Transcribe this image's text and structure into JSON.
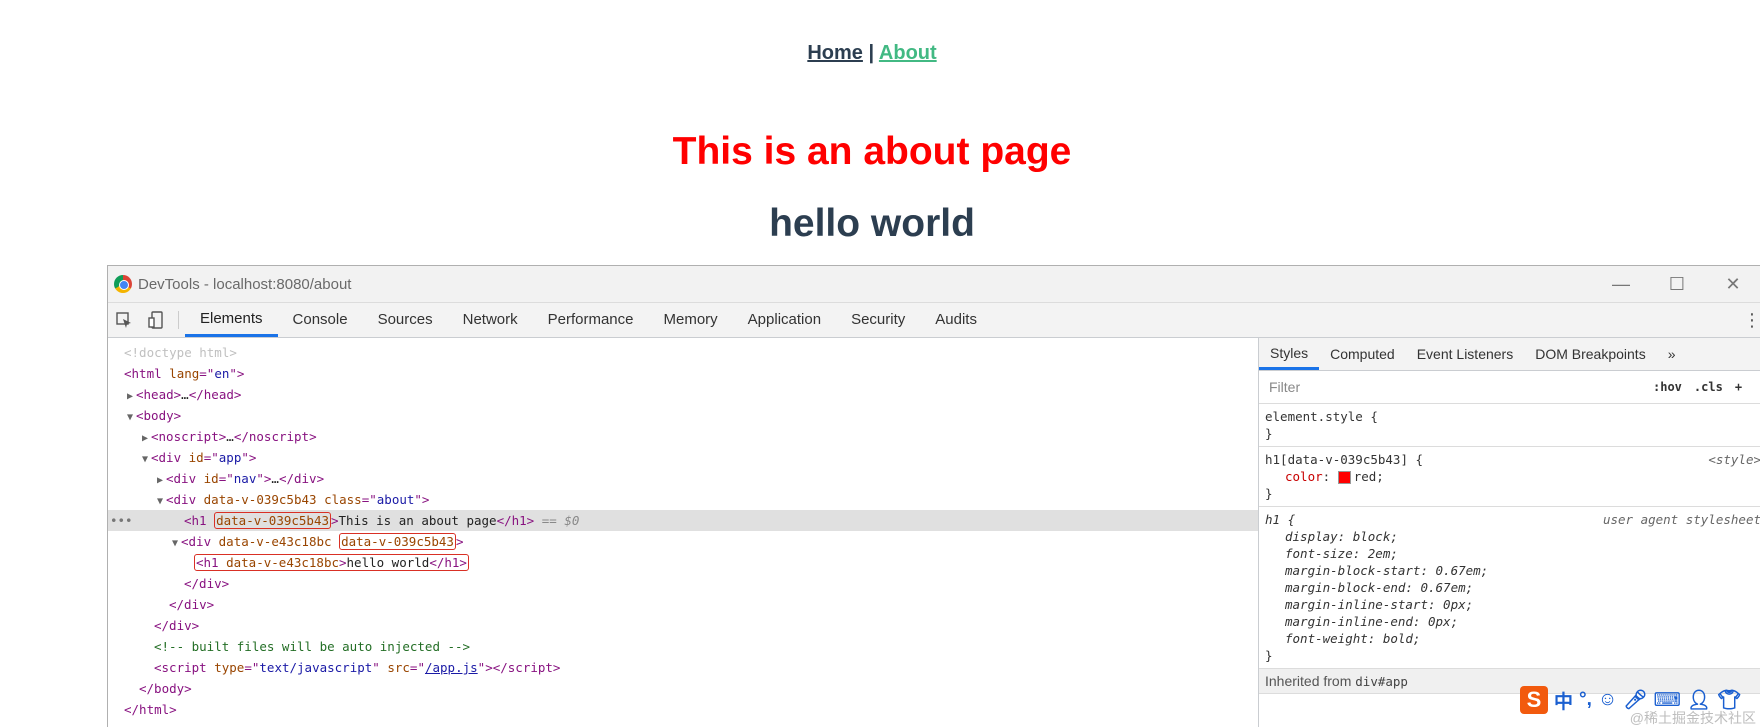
{
  "app": {
    "nav": {
      "home": "Home",
      "separator": "|",
      "about": "About"
    },
    "title": "This is an about page",
    "hello": "hello world"
  },
  "devtools": {
    "window_title": "DevTools - localhost:8080/about",
    "window_controls": [
      "—",
      "☐",
      "✕"
    ],
    "tabs": [
      "Elements",
      "Console",
      "Sources",
      "Network",
      "Performance",
      "Memory",
      "Application",
      "Security",
      "Audits"
    ],
    "active_tab": "Elements",
    "dom": {
      "doctype": "<!doctype html>",
      "html_open": "html",
      "html_attr": "lang",
      "html_val": "en",
      "head": "head",
      "head_ellipsis": "…",
      "body": "body",
      "noscript": "noscript",
      "div_app_attr": "id",
      "div_app_val": "app",
      "div_nav_val": "nav",
      "about_attr1": "data-v-039c5b43",
      "about_class": "class",
      "about_class_val": "about",
      "h1_attr": "data-v-039c5b43",
      "h1_text": "This is an about page",
      "h1_eq": "== $0",
      "div_inner_attr1": "data-v-e43c18bc",
      "div_inner_attr2": "data-v-039c5b43",
      "h1b_attr": "data-v-e43c18bc",
      "h1b_text": "hello world",
      "comment": "<!-- built files will be auto injected -->",
      "script_type_val": "text/javascript",
      "script_src_val": "/app.js"
    },
    "styles": {
      "tabs": [
        "Styles",
        "Computed",
        "Event Listeners",
        "DOM Breakpoints"
      ],
      "more": "»",
      "filter_placeholder": "Filter",
      "hov": ":hov",
      "cls": ".cls",
      "plus": "+",
      "element_style": "element.style {",
      "close_brace": "}",
      "rule1_selector": "h1[data-v-039c5b43] {",
      "rule1_source": "<style>",
      "rule1_prop": "color",
      "rule1_val": "red;",
      "rule2_selector": "h1 {",
      "rule2_source": "user agent stylesheet",
      "ua_decls": [
        "display: block;",
        "font-size: 2em;",
        "margin-block-start: 0.67em;",
        "margin-block-end: 0.67em;",
        "margin-inline-start: 0px;",
        "margin-inline-end: 0px;",
        "font-weight: bold;"
      ],
      "inherited_label": "Inherited from",
      "inherited_from": "div#app"
    }
  },
  "ime": {
    "logo": "S",
    "lang": "中",
    "watermark": "@稀土掘金技术社区"
  }
}
